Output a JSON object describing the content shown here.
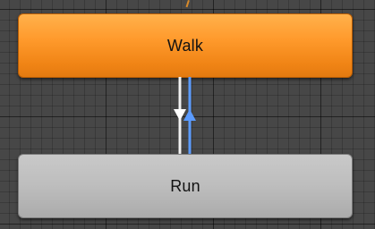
{
  "states": {
    "walk": {
      "label": "Walk"
    },
    "run": {
      "label": "Run"
    }
  },
  "colors": {
    "walk_state": "#ff9a2c",
    "run_state": "#bdbdbd",
    "transition_walk_to_run": "#ffffff",
    "transition_run_to_walk": "#5b9bff",
    "grid_background": "#474747"
  }
}
